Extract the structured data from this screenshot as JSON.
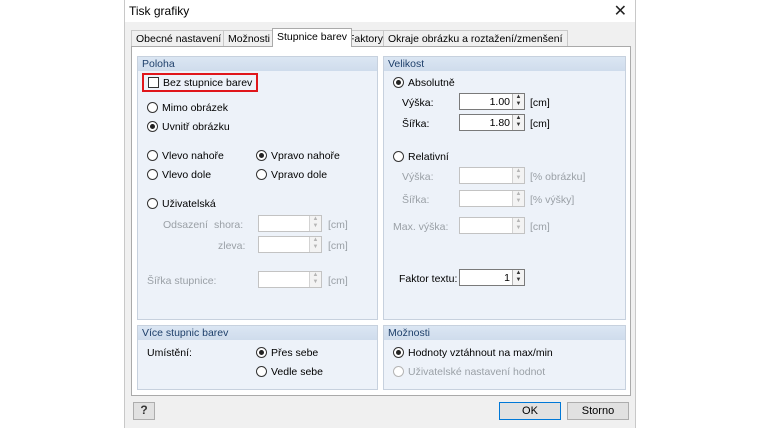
{
  "window": {
    "title": "Tisk grafiky",
    "close_glyph": "✕"
  },
  "tabs": [
    {
      "label": "Obecné nastavení",
      "active": false
    },
    {
      "label": "Možnosti",
      "active": false
    },
    {
      "label": "Stupnice barev",
      "active": true
    },
    {
      "label": "Faktory",
      "active": false
    },
    {
      "label": "Okraje obrázku a roztažení/zmenšení",
      "active": false
    }
  ],
  "poloha": {
    "header": "Poloha",
    "no_scale": {
      "label": "Bez stupnice barev",
      "checked": false
    },
    "outside": {
      "label": "Mimo obrázek",
      "selected": false
    },
    "inside": {
      "label": "Uvnitř obrázku",
      "selected": true
    },
    "top_left": {
      "label": "Vlevo nahoře",
      "selected": false
    },
    "top_right": {
      "label": "Vpravo nahoře",
      "selected": true
    },
    "bottom_left": {
      "label": "Vlevo dole",
      "selected": false
    },
    "bottom_right": {
      "label": "Vpravo dole",
      "selected": false
    },
    "user": {
      "label": "Uživatelská",
      "selected": false
    },
    "offset_label": "Odsazení",
    "from_top_label": "shora:",
    "from_left_label": "zleva:",
    "unit_cm": "[cm]",
    "scale_width_label": "Šířka stupnice:"
  },
  "velikost": {
    "header": "Velikost",
    "absolute": {
      "label": "Absolutně",
      "selected": true
    },
    "height_label": "Výška:",
    "height_value": "1.00",
    "width_label": "Šířka:",
    "width_value": "1.80",
    "unit_cm": "[cm]",
    "relative": {
      "label": "Relativní",
      "selected": false
    },
    "rel_height_label": "Výška:",
    "rel_height_unit": "[% obrázku]",
    "rel_width_label": "Šířka:",
    "rel_width_unit": "[% výšky]",
    "max_height_label": "Max. výška:",
    "max_height_unit": "[cm]",
    "text_factor_label": "Faktor textu:",
    "text_factor_value": "1"
  },
  "multi": {
    "header": "Více stupnic barev",
    "placement_label": "Umístění:",
    "overlap": {
      "label": "Přes sebe",
      "selected": true
    },
    "side_by_side": {
      "label": "Vedle sebe",
      "selected": false
    }
  },
  "moznosti": {
    "header": "Možnosti",
    "stretch": {
      "label": "Hodnoty vztáhnout na max/min",
      "selected": true
    },
    "user_values": {
      "label": "Uživatelské nastavení hodnot",
      "selected": false
    }
  },
  "footer": {
    "ok": "OK",
    "cancel": "Storno",
    "help_icon": "help-icon"
  }
}
